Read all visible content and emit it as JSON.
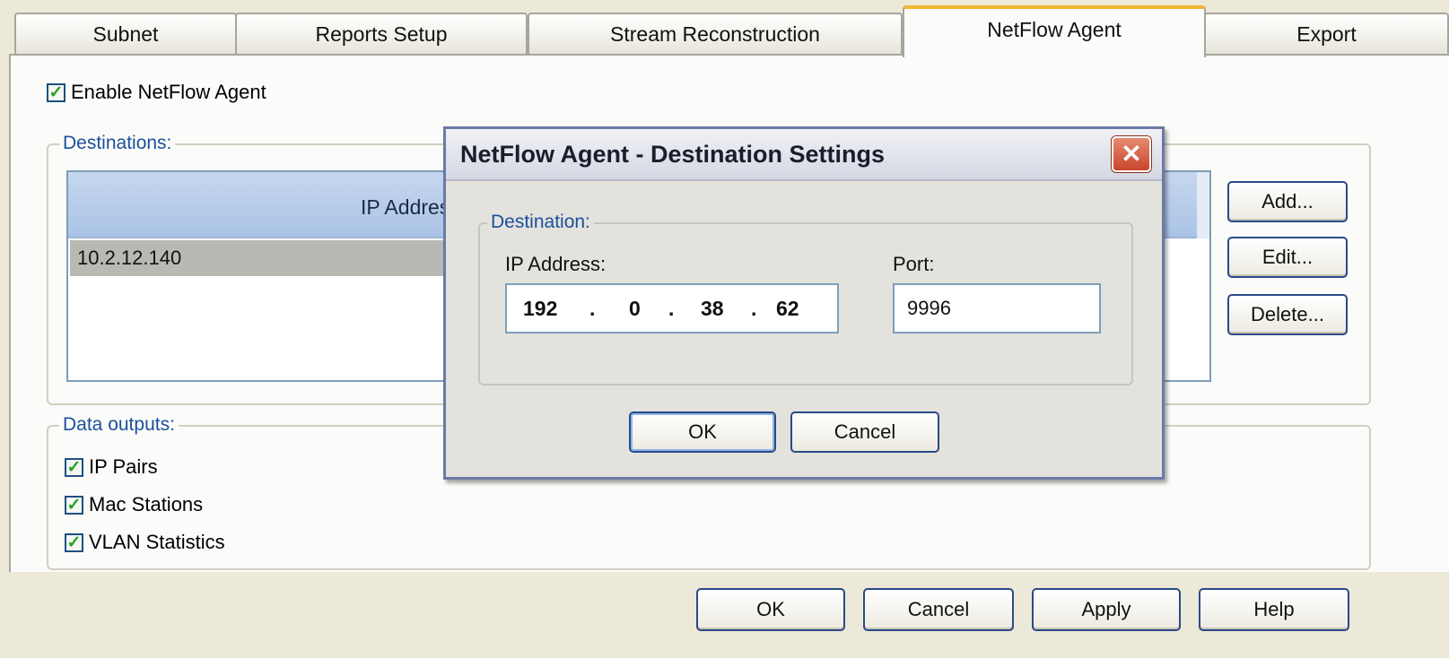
{
  "tabs": [
    {
      "label": "Subnet"
    },
    {
      "label": "Reports Setup"
    },
    {
      "label": "Stream Reconstruction"
    },
    {
      "label": "NetFlow Agent",
      "active": true
    },
    {
      "label": "Export"
    }
  ],
  "enable_agent": {
    "label": "Enable NetFlow Agent",
    "checked": true
  },
  "destinations": {
    "group_label": "Destinations:",
    "column_header": "IP Address",
    "sort_indicator": "▲",
    "rows": [
      "10.2.12.140"
    ],
    "buttons": {
      "add": "Add...",
      "edit": "Edit...",
      "delete": "Delete..."
    }
  },
  "data_outputs": {
    "group_label": "Data outputs:",
    "items": [
      {
        "label": "IP Pairs",
        "checked": true
      },
      {
        "label": "Mac Stations",
        "checked": true
      },
      {
        "label": "VLAN Statistics",
        "checked": true
      }
    ]
  },
  "dialog": {
    "title": "NetFlow Agent - Destination Settings",
    "close_glyph": "✕",
    "group_label": "Destination:",
    "ip_label": "IP Address:",
    "ip_octets": [
      "192",
      "0",
      "38",
      "62"
    ],
    "ip_separator": ".",
    "port_label": "Port:",
    "port_value": "9996",
    "ok_label": "OK",
    "cancel_label": "Cancel"
  },
  "footer": {
    "ok_label": "OK",
    "cancel_label": "Cancel",
    "apply_label": "Apply",
    "help_label": "Help"
  },
  "colors": {
    "accent_tab": "#f2b434",
    "group_label": "#1b4f9c",
    "button_border": "#2b4a86",
    "checkmark": "#21a121"
  },
  "check_glyph": "✓"
}
